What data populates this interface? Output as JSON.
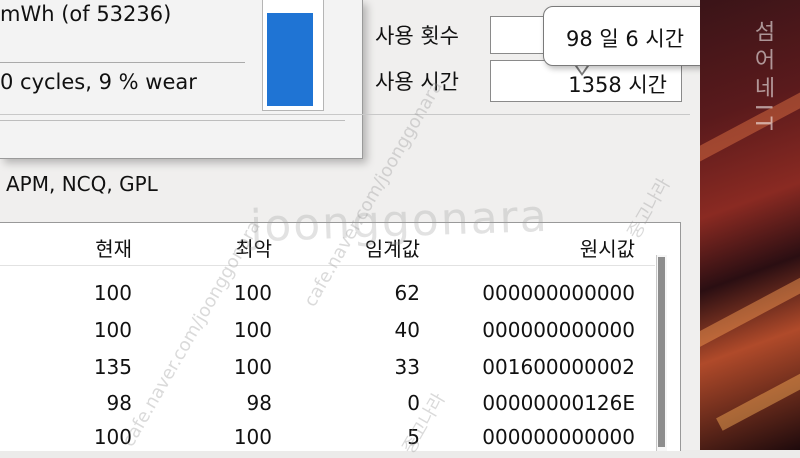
{
  "battery": {
    "capacity_text": "mWh (of 53236)",
    "cycles_text": "0 cycles,   9 % wear",
    "meter_level_percent": 91,
    "meter_color": "#1f74d4"
  },
  "usage": {
    "count_label": "사용 횟수",
    "time_label": "사용 시간",
    "time_value": "1358 시간",
    "tooltip": "98 일 6 시간"
  },
  "features_text": "APM, NCQ, GPL",
  "smart_table": {
    "headers": {
      "current": "현재",
      "worst": "최악",
      "threshold": "임계값",
      "raw": "원시값"
    },
    "rows": [
      {
        "current": "100",
        "worst": "100",
        "threshold": "62",
        "raw": "000000000000"
      },
      {
        "current": "100",
        "worst": "100",
        "threshold": "40",
        "raw": "000000000000"
      },
      {
        "current": "135",
        "worst": "100",
        "threshold": "33",
        "raw": "001600000002"
      },
      {
        "current": "98",
        "worst": "98",
        "threshold": "0",
        "raw": "00000000126E"
      },
      {
        "current": "100",
        "worst": "100",
        "threshold": "5",
        "raw": "000000000000"
      }
    ]
  },
  "watermark": {
    "main": "joonggonara",
    "side": "중고나라",
    "diag": "cafe.naver.com/joonggonara",
    "desktop": "섬어네IT"
  }
}
